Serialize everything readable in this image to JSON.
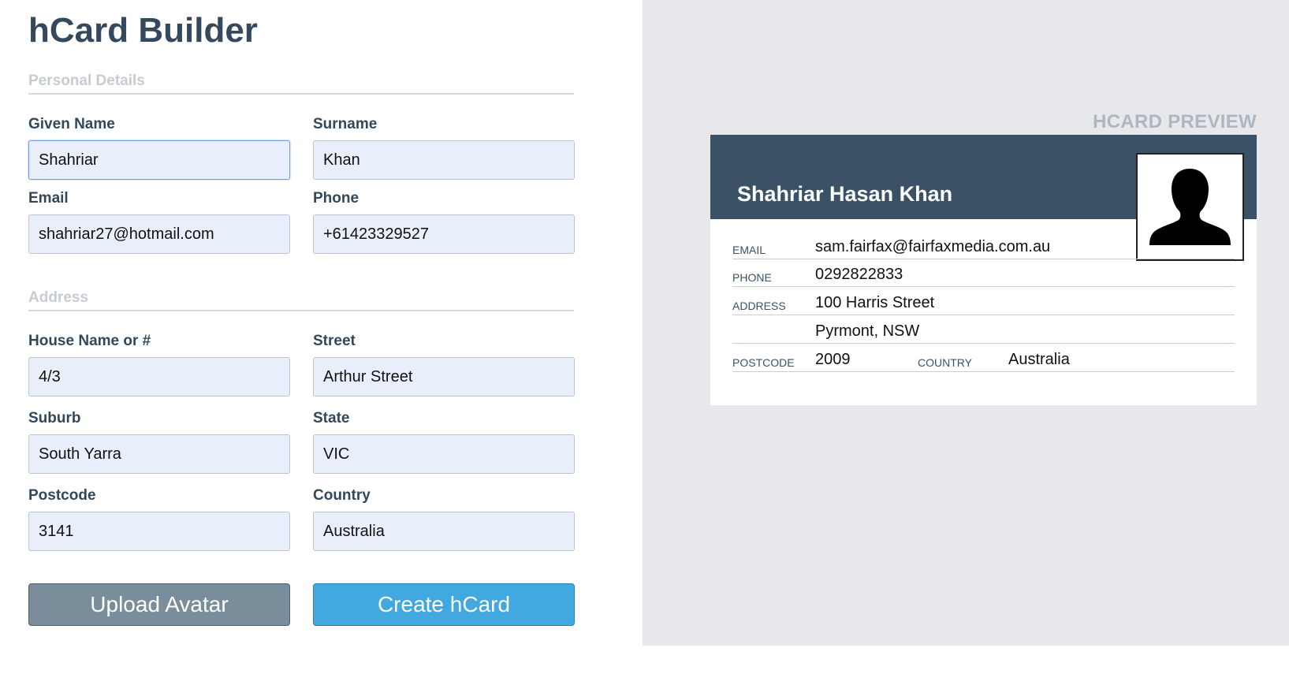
{
  "app": {
    "title": "hCard Builder"
  },
  "sections": {
    "personal": "Personal Details",
    "address": "Address"
  },
  "form": {
    "given_name": {
      "label": "Given Name",
      "value": "Shahriar"
    },
    "surname": {
      "label": "Surname",
      "value": "Khan"
    },
    "email": {
      "label": "Email",
      "value": "shahriar27@hotmail.com"
    },
    "phone": {
      "label": "Phone",
      "value": "+61423329527"
    },
    "house": {
      "label": "House Name or #",
      "value": "4/3"
    },
    "street": {
      "label": "Street",
      "value": "Arthur Street"
    },
    "suburb": {
      "label": "Suburb",
      "value": "South Yarra"
    },
    "state": {
      "label": "State",
      "value": "VIC"
    },
    "postcode": {
      "label": "Postcode",
      "value": "3141"
    },
    "country": {
      "label": "Country",
      "value": "Australia"
    }
  },
  "buttons": {
    "upload": "Upload Avatar",
    "create": "Create hCard"
  },
  "preview": {
    "label": "HCARD PREVIEW",
    "name": "Shahriar Hasan Khan",
    "email_key": "EMAIL",
    "email": "sam.fairfax@fairfaxmedia.com.au",
    "phone_key": "PHONE",
    "phone": "0292822833",
    "address_key": "ADDRESS",
    "address_line1": "100 Harris Street",
    "address_line2": "Pyrmont, NSW",
    "postcode_key": "POSTCODE",
    "postcode": "2009",
    "country_key": "COUNTRY",
    "country": "Australia",
    "avatar_icon": "person-silhouette-icon"
  },
  "colors": {
    "header": "#3b5166",
    "create_button": "#41a8e0",
    "upload_button": "#7a8d9b",
    "input_bg": "#e8effb",
    "preview_bg": "#e6e8ec"
  }
}
